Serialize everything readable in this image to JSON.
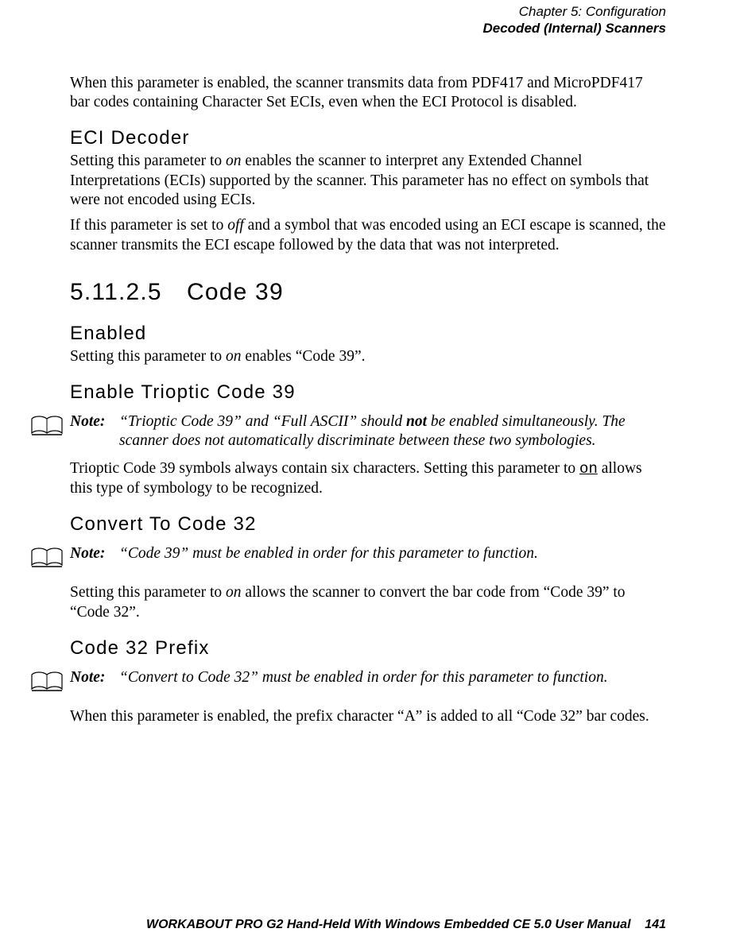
{
  "header": {
    "line1": "Chapter 5: Configuration",
    "line2": "Decoded (Internal) Scanners"
  },
  "body": {
    "intro": "When this parameter is enabled, the scanner transmits data from PDF417 and MicroPDF417 bar codes containing Character Set ECIs, even when the ECI Protocol is disabled.",
    "eci_decoder_heading": "ECI Decoder",
    "eci_decoder_p1_a": "Setting this parameter to ",
    "eci_decoder_p1_on": "on",
    "eci_decoder_p1_b": " enables the scanner to interpret any Extended Channel Interpretations (ECIs) supported by the scanner. This parameter has no effect on symbols that were not encoded using ECIs.",
    "eci_decoder_p2_a": "If this parameter is set to ",
    "eci_decoder_p2_off": "off",
    "eci_decoder_p2_b": " and a symbol that was encoded using an ECI escape is scanned, the scanner transmits the ECI escape followed by the data that was not interpreted.",
    "section_number": "5.11.2.5 Code 39",
    "enabled_heading": "Enabled",
    "enabled_p_a": "Setting this parameter to ",
    "enabled_p_on": "on",
    "enabled_p_b": " enables “Code 39”.",
    "trioptic_heading": "Enable Trioptic Code 39",
    "note_label": "Note:",
    "note1_a": "“Trioptic Code 39” and “Full ASCII” should ",
    "note1_not": "not",
    "note1_b": " be enabled simultaneously. The scanner does not automatically discriminate between these two symbologies.",
    "trioptic_p_a": "Trioptic Code 39 symbols always contain six characters. Setting this parameter to ",
    "trioptic_p_on": "on",
    "trioptic_p_b": " allows this type of symbology to be recognized.",
    "convert_heading": "Convert To Code 32",
    "note2": "“Code 39” must be enabled in order for this parameter to function.",
    "convert_p_a": "Setting this parameter to ",
    "convert_p_on": "on",
    "convert_p_b": " allows the scanner to convert the bar code from “Code 39” to “Code 32”.",
    "prefix_heading": "Code 32 Prefix",
    "note3": " “Convert to Code 32” must be enabled in order for this parameter to function.",
    "prefix_p": "When this parameter is enabled, the prefix character “A” is added to all “Code 32” bar codes."
  },
  "footer": {
    "title": "WORKABOUT PRO G2 Hand-Held With Windows Embedded CE 5.0 User Manual",
    "page": "141"
  }
}
